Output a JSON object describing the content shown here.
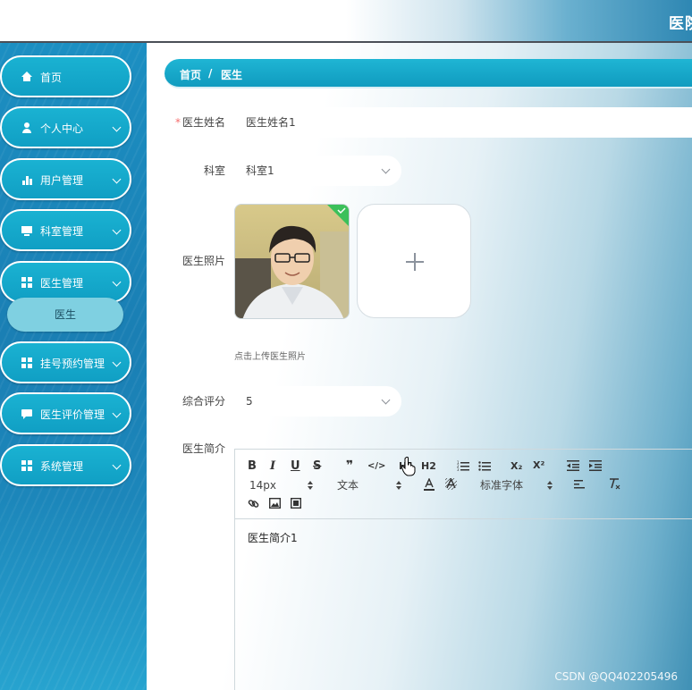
{
  "header": {
    "title": "医院"
  },
  "sidebar": {
    "items": [
      {
        "label": "首页",
        "icon": "home-icon",
        "has_arrow": false
      },
      {
        "label": "个人中心",
        "icon": "user-icon",
        "has_arrow": true
      },
      {
        "label": "用户管理",
        "icon": "bar-chart-icon",
        "has_arrow": true
      },
      {
        "label": "科室管理",
        "icon": "monitor-icon",
        "has_arrow": true
      },
      {
        "label": "医生管理",
        "icon": "grid-icon",
        "has_arrow": true
      },
      {
        "label": "挂号预约管理",
        "icon": "grid-icon",
        "has_arrow": true
      },
      {
        "label": "医生评价管理",
        "icon": "chat-icon",
        "has_arrow": true
      },
      {
        "label": "系统管理",
        "icon": "grid-icon",
        "has_arrow": true
      }
    ],
    "submenu": {
      "label": "医生"
    }
  },
  "breadcrumb": {
    "home": "首页",
    "separator": "/",
    "current": "医生"
  },
  "form": {
    "name": {
      "label": "医生姓名",
      "required_mark": "*",
      "value": "医生姓名1"
    },
    "dept": {
      "label": "科室",
      "value": "科室1"
    },
    "photo": {
      "label": "医生照片",
      "hint": "点击上传医生照片",
      "upload_plus": "+"
    },
    "rating": {
      "label": "综合评分",
      "value": "5"
    },
    "intro": {
      "label": "医生简介"
    }
  },
  "editor": {
    "row1": [
      "B",
      "I",
      "U",
      "S",
      "❞",
      "</>",
      "H1",
      "H2"
    ],
    "sub": "X₂",
    "sup": "X²",
    "size": "14px",
    "text_type": "文本",
    "font": "标准字体",
    "content": "医生简介1"
  },
  "watermark": "CSDN @QQ402205496",
  "colors": {
    "sidebar_bg": "#1a7fb4",
    "menu_item": "#109fc4",
    "submenu": "#7fd0e1",
    "breadcrumb": "#109bbf",
    "required": "#f56c6c"
  }
}
